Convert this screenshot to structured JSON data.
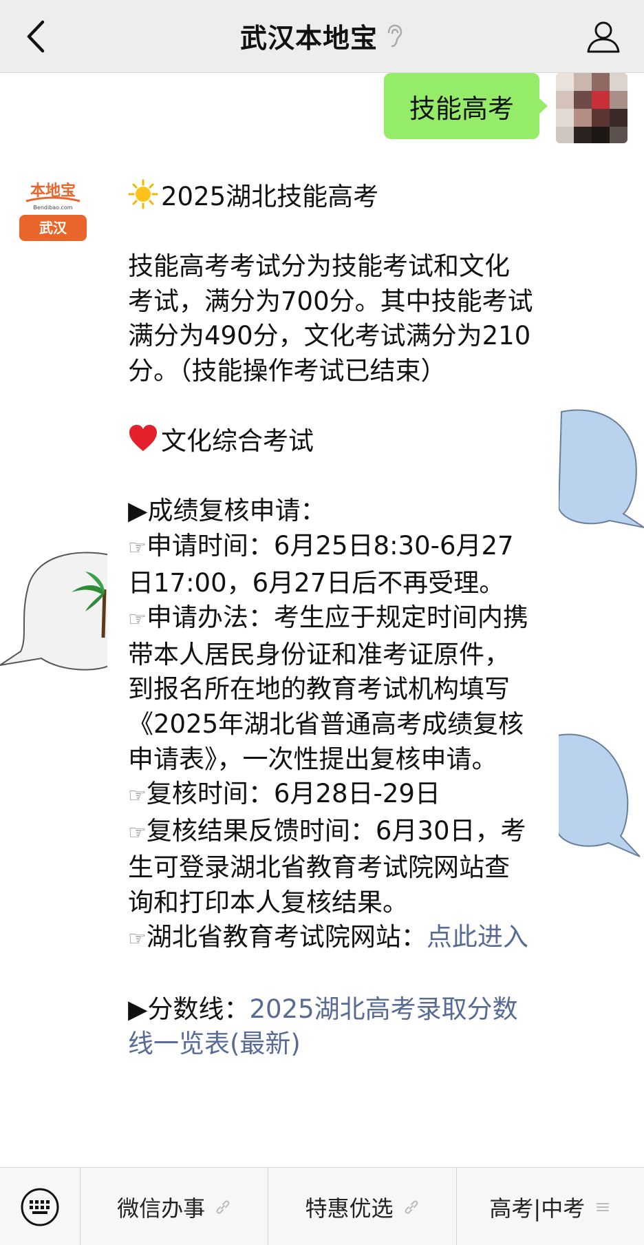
{
  "header": {
    "title": "武汉本地宝"
  },
  "outgoing": {
    "text": "技能高考"
  },
  "bot": {
    "logo_top": "本地宝",
    "logo_domain": "Bendibao.com",
    "logo_city": "武汉"
  },
  "message": {
    "title": "2025湖北技能高考",
    "intro": "技能高考考试分为技能考试和文化考试，满分为700分。其中技能考试满分为490分，文化考试满分为210分。（技能操作考试已结束）",
    "section_title": "文化综合考试",
    "review_heading": "▶成绩复核申请：",
    "item1": "申请时间：6月25日8:30-6月27日17:00，6月27日后不再受理。",
    "item2": "申请办法：考生应于规定时间内携带本人居民身份证和准考证原件，到报名所在地的教育考试机构填写《2025年湖北省普通高考成绩复核申请表》，一次性提出复核申请。",
    "item3": "复核时间：6月28日-29日",
    "item4": "复核结果反馈时间：6月30日，考生可登录湖北省教育考试院网站查询和打印本人复核结果。",
    "item5_prefix": "湖北省教育考试院网站：",
    "item5_link": "点此进入",
    "score_prefix": "▶分数线：",
    "score_link": "2025湖北高考录取分数线一览表(最新)"
  },
  "menu": {
    "items": [
      "微信办事",
      "特惠优选",
      "高考|中考"
    ]
  },
  "colors": {
    "bubble_green": "#95ec69",
    "link_blue": "#576b95",
    "brand_orange": "#e8662b"
  }
}
